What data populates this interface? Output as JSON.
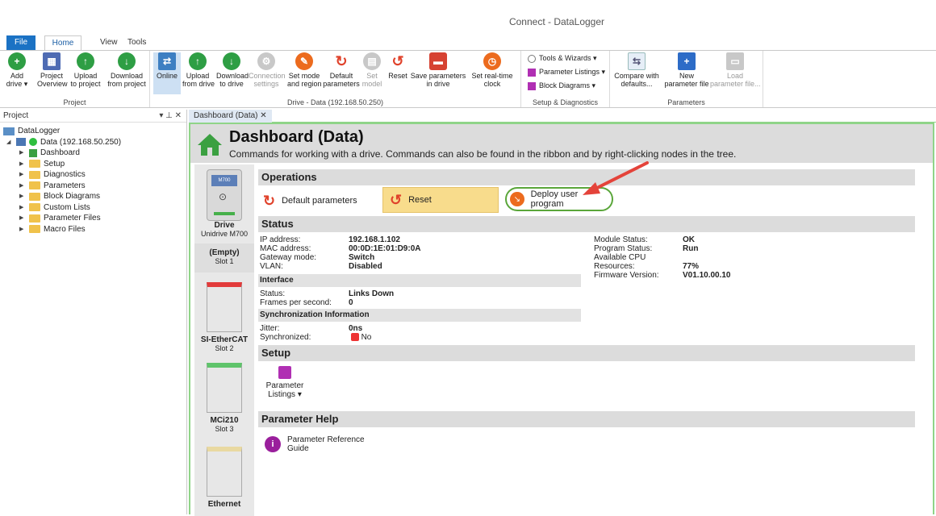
{
  "window": {
    "title": "Connect - DataLogger"
  },
  "tabs": {
    "file": "File",
    "home": "Home",
    "view": "View",
    "tools": "Tools"
  },
  "ribbon": {
    "project_group": "Project",
    "add_drive": "Add\ndrive ▾",
    "project_overview": "Project\nOverview",
    "upload_to_project": "Upload\nto project",
    "download_from_project": "Download\nfrom project",
    "drive_group": "Drive - Data (192.168.50.250)",
    "online": "Online",
    "upload_from_drive": "Upload\nfrom drive",
    "download_to_drive": "Download\nto drive",
    "connection_settings": "Connection\nsettings",
    "set_mode_region": "Set mode\nand region",
    "default_parameters": "Default\nparameters",
    "set_model": "Set\nmodel",
    "reset": "Reset",
    "save_parameters": "Save parameters\nin drive",
    "set_clock": "Set real-time\nclock",
    "setup_group": "Setup & Diagnostics",
    "tools_wizards": "Tools & Wizards  ▾",
    "parameter_listings": "Parameter Listings  ▾",
    "block_diagrams": "Block Diagrams   ▾",
    "params_group": "Parameters",
    "compare_defaults": "Compare with\ndefaults...",
    "new_param_file": "New\nparameter file",
    "load_param_file": "Load\nparameter file..."
  },
  "project_panel": {
    "title": "Project",
    "controls": "▾  ⊥  ✕",
    "root": "DataLogger",
    "drive": "Data (192.168.50.250)",
    "items": [
      "Dashboard",
      "Setup",
      "Diagnostics",
      "Parameters",
      "Block Diagrams",
      "Custom Lists",
      "Parameter Files",
      "Macro Files"
    ]
  },
  "document_tab": "Dashboard (Data)  ✕",
  "dashboard": {
    "title": "Dashboard (Data)",
    "subtitle": "Commands for working with a drive. Commands can also be found in the ribbon and by right-clicking nodes in the tree."
  },
  "devices": [
    {
      "name": "Drive",
      "sub": "Unidrive M700",
      "label": "M700"
    },
    {
      "name": "(Empty)",
      "sub": "Slot 1"
    },
    {
      "name": "SI-EtherCAT",
      "sub": "Slot 2"
    },
    {
      "name": "MCi210",
      "sub": "Slot 3"
    },
    {
      "name": "Ethernet",
      "sub": ""
    }
  ],
  "operations": {
    "heading": "Operations",
    "default_parameters": "Default parameters",
    "reset": "Reset",
    "deploy": "Deploy user program"
  },
  "status": {
    "heading": "Status",
    "left": [
      {
        "k": "IP address:",
        "v": "192.168.1.102"
      },
      {
        "k": "MAC address:",
        "v": "00:0D:1E:01:D9:0A"
      },
      {
        "k": "Gateway mode:",
        "v": "Switch"
      },
      {
        "k": "VLAN:",
        "v": "Disabled"
      }
    ],
    "right": [
      {
        "k": "Module Status:",
        "v": "OK"
      },
      {
        "k": "Program Status:",
        "v": "Run"
      },
      {
        "k": "Available CPU Resources:",
        "v": "77%"
      },
      {
        "k": "Firmware Version:",
        "v": "V01.10.00.10"
      }
    ],
    "interface_heading": "Interface",
    "interface": [
      {
        "k": "Status:",
        "v": "Links Down"
      },
      {
        "k": "Frames per second:",
        "v": "0"
      }
    ],
    "sync_heading": "Synchronization Information",
    "jitter_k": "Jitter:",
    "jitter_v": "0ns",
    "synced_k": "Synchronized:",
    "synced_v": "No"
  },
  "setup": {
    "heading": "Setup",
    "listings": "Parameter\nListings ▾"
  },
  "help": {
    "heading": "Parameter Help",
    "guide": "Parameter Reference\nGuide"
  },
  "colors": {
    "accent": "#1b72c4",
    "highlight": "#f8dc8c",
    "green_border": "#8fd488",
    "arrow": "#e4433a",
    "circle": "#5aa63a"
  }
}
